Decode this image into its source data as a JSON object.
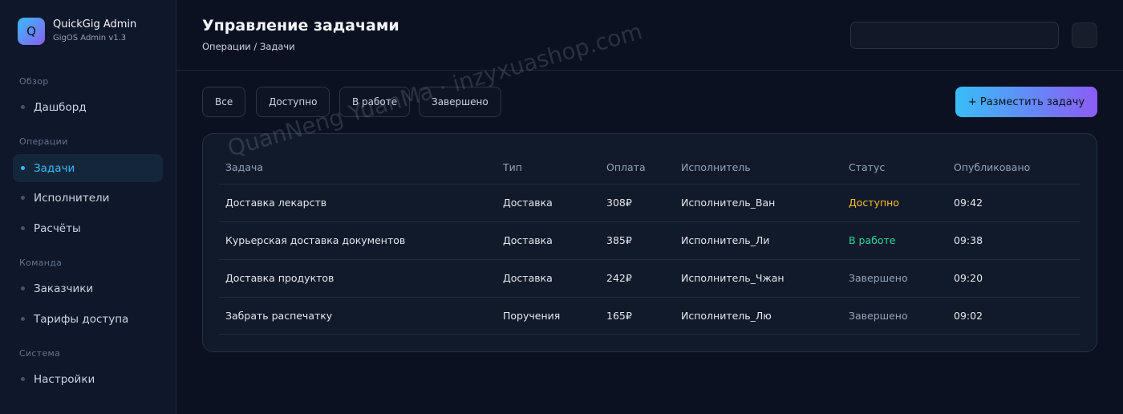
{
  "brand": {
    "logo_letter": "Q",
    "name": "QuickGig Admin",
    "version": "GigOS Admin v1.3"
  },
  "sidebar": {
    "sections": [
      {
        "title": "Обзор",
        "items": [
          {
            "label": "Дашборд"
          }
        ]
      },
      {
        "title": "Операции",
        "items": [
          {
            "label": "Задачи",
            "active": true
          },
          {
            "label": "Исполнители"
          },
          {
            "label": "Расчёты"
          }
        ]
      },
      {
        "title": "Команда",
        "items": [
          {
            "label": "Заказчики"
          },
          {
            "label": "Тарифы доступа"
          }
        ]
      },
      {
        "title": "Система",
        "items": [
          {
            "label": "Настройки"
          }
        ]
      }
    ]
  },
  "header": {
    "title": "Управление задачами",
    "breadcrumb": "Операции / Задачи",
    "search": {
      "value": "",
      "placeholder": ""
    }
  },
  "filters": [
    "Все",
    "Доступно",
    "В работе",
    "Завершено"
  ],
  "cta_label": "+ Разместить задачу",
  "table": {
    "columns": [
      "Задача",
      "Тип",
      "Оплата",
      "Исполнитель",
      "Статус",
      "Опубликовано"
    ],
    "rows": [
      {
        "task": "Доставка лекарств",
        "type": "Доставка",
        "pay": "308₽",
        "worker": "Исполнитель_Ван",
        "status": "Доступно",
        "posted": "09:42"
      },
      {
        "task": "Курьерская доставка документов",
        "type": "Доставка",
        "pay": "385₽",
        "worker": "Исполнитель_Ли",
        "status": "В работе",
        "posted": "09:38"
      },
      {
        "task": "Доставка продуктов",
        "type": "Доставка",
        "pay": "242₽",
        "worker": "Исполнитель_Чжан",
        "status": "Завершено",
        "posted": "09:20"
      },
      {
        "task": "Забрать распечатку",
        "type": "Поручения",
        "pay": "165₽",
        "worker": "Исполнитель_Лю",
        "status": "Завершено",
        "posted": "09:02"
      }
    ]
  },
  "status_colors": {
    "Доступно": "#fbbf24",
    "В работе": "#34d399",
    "Завершено": "#94a3b8"
  },
  "accent": "#38bdf8",
  "watermark": "QuanNeng YuanMa · inzyxuashop.com"
}
